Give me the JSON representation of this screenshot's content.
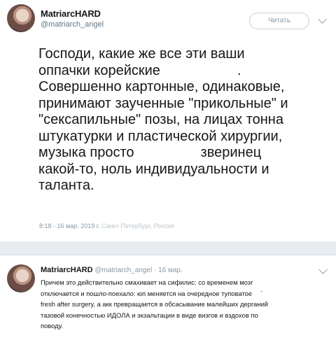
{
  "main_tweet": {
    "display_name": "MatriarcHARD",
    "handle": "@matriarch_angel",
    "follow_label": "Читать",
    "lines": [
      "Господи, какие же все эти ваши",
      "оппачки корейские",
      "Совершенно картонные, одинаковые,",
      "принимают заученные \"прикольные\" и",
      "\"сексапильные\" позы, на лицах тонна",
      "штукатурки и пластической хирургии,",
      "музыка просто",
      "зверинец",
      "какой-то, ноль индивидуальности и",
      "таланта."
    ],
    "line2_tail": ".",
    "time_date": "8:18 - 16 мар. 2019 г.",
    "location": "Санкт-Петербург, Россия"
  },
  "reply_tweet": {
    "display_name": "MatriarcHARD",
    "handle": "@matriarch_angel",
    "date": "16 мар.",
    "lines": [
      "Причем это действительно смахивает на сифилис: со временем мозг",
      "отключается и пошло-поехало: юп меняется на очередное туповатое",
      "fresh after surgery, а акк превращается в обсасывание малейших дерганий",
      "тазовой конечностью ИДОЛА и экзальтации в виде визгов и вздохов по",
      "поводу."
    ],
    "line2_tail": "`"
  }
}
